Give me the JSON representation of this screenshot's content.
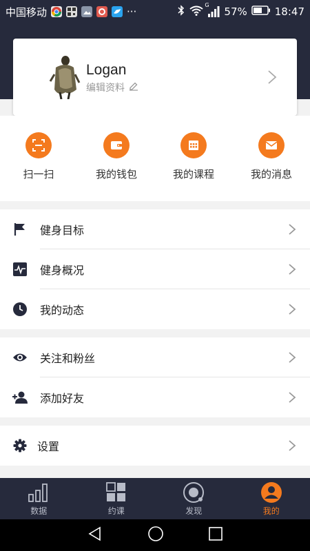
{
  "status_bar": {
    "carrier": "中国移动",
    "more": "···",
    "network": "G",
    "battery": "57%",
    "time": "18:47"
  },
  "profile": {
    "name": "Logan",
    "edit_label": "编辑资料"
  },
  "quick_actions": [
    {
      "label": "扫一扫",
      "icon": "scan-icon"
    },
    {
      "label": "我的钱包",
      "icon": "wallet-icon"
    },
    {
      "label": "我的课程",
      "icon": "calendar-icon"
    },
    {
      "label": "我的消息",
      "icon": "mail-icon"
    }
  ],
  "menu_section_1": [
    {
      "label": "健身目标",
      "icon": "flag-icon"
    },
    {
      "label": "健身概况",
      "icon": "pulse-icon"
    },
    {
      "label": "我的动态",
      "icon": "clock-icon"
    }
  ],
  "menu_section_2": [
    {
      "label": "关注和粉丝",
      "icon": "eye-icon"
    },
    {
      "label": "添加好友",
      "icon": "add-person-icon"
    }
  ],
  "menu_section_3": [
    {
      "label": "设置",
      "icon": "gear-icon"
    }
  ],
  "bottom_nav": [
    {
      "label": "数据",
      "icon": "bar-chart-icon",
      "active": false
    },
    {
      "label": "约课",
      "icon": "grid-icon",
      "active": false
    },
    {
      "label": "发现",
      "icon": "discover-icon",
      "active": false
    },
    {
      "label": "我的",
      "icon": "profile-icon",
      "active": true
    }
  ],
  "colors": {
    "header_bg": "#262a3c",
    "accent": "#f47a1e"
  }
}
